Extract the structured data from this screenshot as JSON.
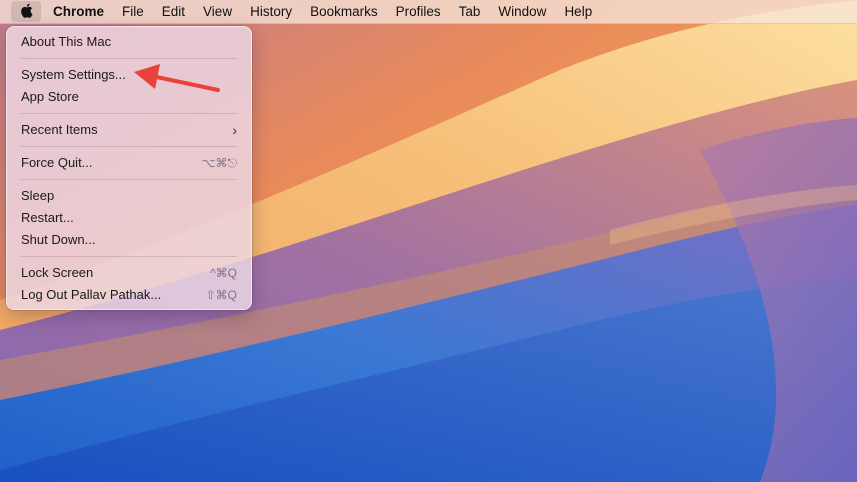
{
  "menubar": {
    "apple_icon": "apple-logo-icon",
    "app_name": "Chrome",
    "items": [
      "File",
      "Edit",
      "View",
      "History",
      "Bookmarks",
      "Profiles",
      "Tab",
      "Window",
      "Help"
    ]
  },
  "apple_menu": {
    "about": "About This Mac",
    "system_settings": "System Settings...",
    "app_store": "App Store",
    "recent_items": "Recent Items",
    "recent_items_icon": "chevron-right-icon",
    "force_quit": "Force Quit...",
    "force_quit_shortcut": "⌥⌘⎋",
    "sleep": "Sleep",
    "restart": "Restart...",
    "shut_down": "Shut Down...",
    "lock_screen": "Lock Screen",
    "lock_screen_shortcut": "^⌘Q",
    "log_out": "Log Out Pallav Pathak...",
    "log_out_shortcut": "⇧⌘Q"
  },
  "annotation": {
    "arrow_color": "#e8423a"
  }
}
